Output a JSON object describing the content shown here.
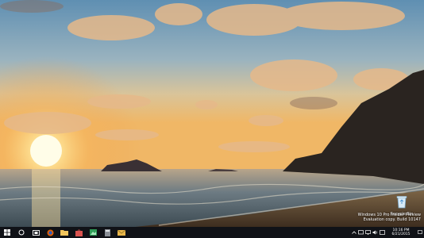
{
  "desktop": {
    "recycle_bin_label": "Recycle Bin",
    "watermark": {
      "line1": "Windows 10 Pro Insider Preview",
      "line2": "Evaluation copy. Build 10147"
    }
  },
  "taskbar": {
    "pinned_icons": [
      "start-icon",
      "search-icon",
      "task-view-icon",
      "firefox-icon",
      "file-explorer-icon",
      "store-icon",
      "photos-icon",
      "calculator-icon",
      "mail-icon"
    ],
    "tray": {
      "clock_time": "10:16 PM",
      "clock_date": "6/21/2015"
    }
  }
}
